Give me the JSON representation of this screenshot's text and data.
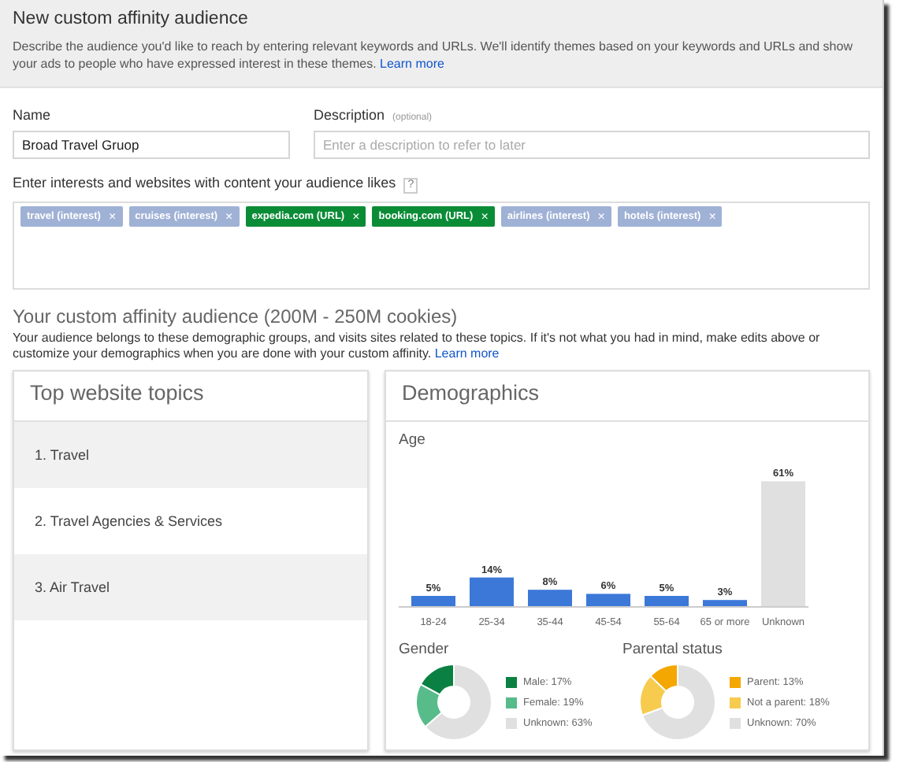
{
  "header": {
    "title": "New custom affinity audience",
    "description": "Describe the audience you'd like to reach by entering relevant keywords and URLs. We'll identify themes based on your keywords and URLs and show your ads to people who have expressed interest in these themes.",
    "link": "Learn more"
  },
  "name_field": {
    "label": "Name",
    "value": "Broad Travel Gruop"
  },
  "description_field": {
    "label": "Description",
    "hint": "(optional)",
    "placeholder": "Enter a description to refer to later"
  },
  "interests": {
    "label": "Enter interests and websites with content your audience likes",
    "help": "?",
    "tags": [
      {
        "text": "travel (interest)",
        "kind": "interest",
        "remove": "×"
      },
      {
        "text": "cruises (interest)",
        "kind": "interest",
        "remove": "×"
      },
      {
        "text": "expedia.com (URL)",
        "kind": "url",
        "remove": "×"
      },
      {
        "text": "booking.com (URL)",
        "kind": "url",
        "remove": "×"
      },
      {
        "text": "airlines (interest)",
        "kind": "interest",
        "remove": "×"
      },
      {
        "text": "hotels (interest)",
        "kind": "interest",
        "remove": "×"
      }
    ]
  },
  "audience": {
    "title": "Your custom affinity audience (200M - 250M cookies)",
    "description": "Your audience belongs to these demographic groups, and visits sites related to these topics. If it's not what you had in mind, make edits above or customize your demographics when you are done with your custom affinity.",
    "link": "Learn more"
  },
  "topics": {
    "title": "Top website topics",
    "items": [
      "1. Travel",
      "2. Travel Agencies & Services",
      "3. Air Travel"
    ]
  },
  "demographics": {
    "title": "Demographics",
    "age": {
      "title": "Age",
      "chart_data": {
        "type": "bar",
        "categories": [
          "18-24",
          "25-34",
          "35-44",
          "45-54",
          "55-64",
          "65 or more",
          "Unknown"
        ],
        "stacked": true,
        "series": [
          {
            "color": "#3c78d8",
            "values": [
              5,
              14,
              8,
              6,
              5,
              3,
              null
            ],
            "value_labels": [
              "5%",
              "14%",
              "8%",
              "6%",
              "5%",
              "3%",
              null
            ]
          },
          {
            "color": "#e0e0e0",
            "values": [
              null,
              null,
              null,
              null,
              null,
              null,
              61
            ],
            "value_labels": [
              null,
              null,
              null,
              null,
              null,
              null,
              "61%"
            ]
          }
        ]
      }
    },
    "gender": {
      "title": "Gender",
      "chart_data": {
        "type": "donut",
        "categories": [
          "Male: 17%",
          "Female: 19%",
          "Unknown: 63%"
        ],
        "values": [
          17,
          19,
          63
        ],
        "legend": "right",
        "colors": [
          "#0b8043",
          "#57bb8a",
          "#e0e0e0"
        ]
      }
    },
    "parental": {
      "title": "Parental status",
      "chart_data": {
        "type": "donut",
        "categories": [
          "Parent: 13%",
          "Not a parent: 18%",
          "Unknown: 70%"
        ],
        "values": [
          13,
          18,
          70
        ],
        "legend": "right",
        "colors": [
          "#f4a700",
          "#f7cb4d",
          "#e0e0e0"
        ]
      }
    }
  }
}
